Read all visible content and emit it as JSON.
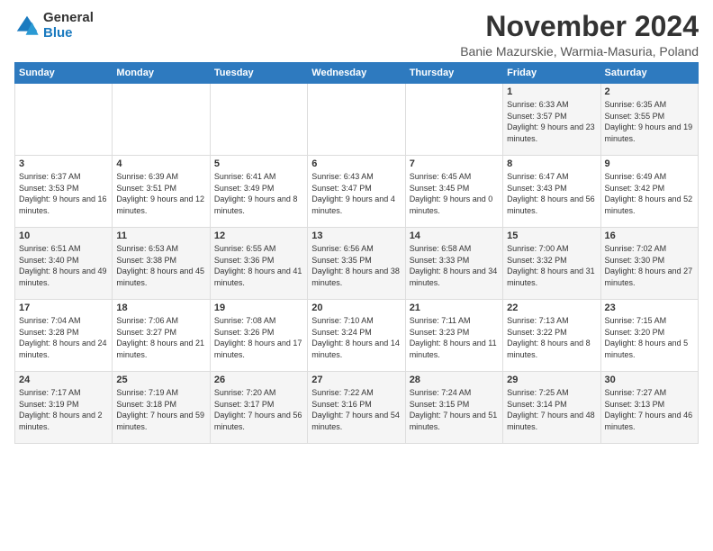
{
  "logo": {
    "general": "General",
    "blue": "Blue"
  },
  "title": "November 2024",
  "location": "Banie Mazurskie, Warmia-Masuria, Poland",
  "weekdays": [
    "Sunday",
    "Monday",
    "Tuesday",
    "Wednesday",
    "Thursday",
    "Friday",
    "Saturday"
  ],
  "weeks": [
    [
      {
        "day": "",
        "info": ""
      },
      {
        "day": "",
        "info": ""
      },
      {
        "day": "",
        "info": ""
      },
      {
        "day": "",
        "info": ""
      },
      {
        "day": "",
        "info": ""
      },
      {
        "day": "1",
        "info": "Sunrise: 6:33 AM\nSunset: 3:57 PM\nDaylight: 9 hours and 23 minutes."
      },
      {
        "day": "2",
        "info": "Sunrise: 6:35 AM\nSunset: 3:55 PM\nDaylight: 9 hours and 19 minutes."
      }
    ],
    [
      {
        "day": "3",
        "info": "Sunrise: 6:37 AM\nSunset: 3:53 PM\nDaylight: 9 hours and 16 minutes."
      },
      {
        "day": "4",
        "info": "Sunrise: 6:39 AM\nSunset: 3:51 PM\nDaylight: 9 hours and 12 minutes."
      },
      {
        "day": "5",
        "info": "Sunrise: 6:41 AM\nSunset: 3:49 PM\nDaylight: 9 hours and 8 minutes."
      },
      {
        "day": "6",
        "info": "Sunrise: 6:43 AM\nSunset: 3:47 PM\nDaylight: 9 hours and 4 minutes."
      },
      {
        "day": "7",
        "info": "Sunrise: 6:45 AM\nSunset: 3:45 PM\nDaylight: 9 hours and 0 minutes."
      },
      {
        "day": "8",
        "info": "Sunrise: 6:47 AM\nSunset: 3:43 PM\nDaylight: 8 hours and 56 minutes."
      },
      {
        "day": "9",
        "info": "Sunrise: 6:49 AM\nSunset: 3:42 PM\nDaylight: 8 hours and 52 minutes."
      }
    ],
    [
      {
        "day": "10",
        "info": "Sunrise: 6:51 AM\nSunset: 3:40 PM\nDaylight: 8 hours and 49 minutes."
      },
      {
        "day": "11",
        "info": "Sunrise: 6:53 AM\nSunset: 3:38 PM\nDaylight: 8 hours and 45 minutes."
      },
      {
        "day": "12",
        "info": "Sunrise: 6:55 AM\nSunset: 3:36 PM\nDaylight: 8 hours and 41 minutes."
      },
      {
        "day": "13",
        "info": "Sunrise: 6:56 AM\nSunset: 3:35 PM\nDaylight: 8 hours and 38 minutes."
      },
      {
        "day": "14",
        "info": "Sunrise: 6:58 AM\nSunset: 3:33 PM\nDaylight: 8 hours and 34 minutes."
      },
      {
        "day": "15",
        "info": "Sunrise: 7:00 AM\nSunset: 3:32 PM\nDaylight: 8 hours and 31 minutes."
      },
      {
        "day": "16",
        "info": "Sunrise: 7:02 AM\nSunset: 3:30 PM\nDaylight: 8 hours and 27 minutes."
      }
    ],
    [
      {
        "day": "17",
        "info": "Sunrise: 7:04 AM\nSunset: 3:28 PM\nDaylight: 8 hours and 24 minutes."
      },
      {
        "day": "18",
        "info": "Sunrise: 7:06 AM\nSunset: 3:27 PM\nDaylight: 8 hours and 21 minutes."
      },
      {
        "day": "19",
        "info": "Sunrise: 7:08 AM\nSunset: 3:26 PM\nDaylight: 8 hours and 17 minutes."
      },
      {
        "day": "20",
        "info": "Sunrise: 7:10 AM\nSunset: 3:24 PM\nDaylight: 8 hours and 14 minutes."
      },
      {
        "day": "21",
        "info": "Sunrise: 7:11 AM\nSunset: 3:23 PM\nDaylight: 8 hours and 11 minutes."
      },
      {
        "day": "22",
        "info": "Sunrise: 7:13 AM\nSunset: 3:22 PM\nDaylight: 8 hours and 8 minutes."
      },
      {
        "day": "23",
        "info": "Sunrise: 7:15 AM\nSunset: 3:20 PM\nDaylight: 8 hours and 5 minutes."
      }
    ],
    [
      {
        "day": "24",
        "info": "Sunrise: 7:17 AM\nSunset: 3:19 PM\nDaylight: 8 hours and 2 minutes."
      },
      {
        "day": "25",
        "info": "Sunrise: 7:19 AM\nSunset: 3:18 PM\nDaylight: 7 hours and 59 minutes."
      },
      {
        "day": "26",
        "info": "Sunrise: 7:20 AM\nSunset: 3:17 PM\nDaylight: 7 hours and 56 minutes."
      },
      {
        "day": "27",
        "info": "Sunrise: 7:22 AM\nSunset: 3:16 PM\nDaylight: 7 hours and 54 minutes."
      },
      {
        "day": "28",
        "info": "Sunrise: 7:24 AM\nSunset: 3:15 PM\nDaylight: 7 hours and 51 minutes."
      },
      {
        "day": "29",
        "info": "Sunrise: 7:25 AM\nSunset: 3:14 PM\nDaylight: 7 hours and 48 minutes."
      },
      {
        "day": "30",
        "info": "Sunrise: 7:27 AM\nSunset: 3:13 PM\nDaylight: 7 hours and 46 minutes."
      }
    ]
  ]
}
